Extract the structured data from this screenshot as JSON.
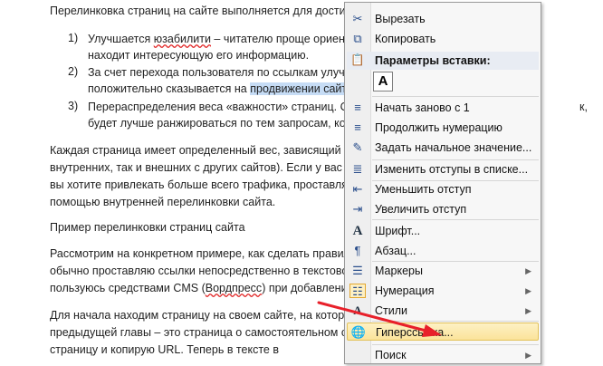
{
  "document": {
    "intro": "Перелинковка страниц на сайте выполняется для достиже",
    "list": [
      {
        "num": "1)",
        "line1": "Улучшается юзабилити – читателю проще ориенти",
        "line2": "находит интересующую его информацию."
      },
      {
        "num": "2)",
        "line1": "За счет перехода пользователя по ссылкам улучша",
        "line2a": "положительно сказывается на ",
        "line2b": "продвижении сайта"
      },
      {
        "num": "3)",
        "line1": "Перераспределения веса «важности» страниц. Стр",
        "line2": "будет лучше ранжироваться по тем запросам, кото"
      }
    ],
    "para1": [
      "Каждая страница имеет определенный вес, зависящий от",
      "внутренних, так и внешних с других сайтов). Если у вас на",
      "вы хотите привлекать больше всего трафика, проставляйт",
      "помощью внутренней перелинковки сайта."
    ],
    "heading": "Пример перелинковки страниц сайта",
    "para2": [
      "Рассмотрим на конкретном примере, как сделать правиль",
      "обычно проставляю ссылки непосредственно в текстовом",
      "пользуюсь средствами CMS (Вордпресс) при добавлении"
    ],
    "para3": [
      "Для начала находим страницу на своем сайте, на которую",
      "предыдущей главы – это страница о самостоятельном сео",
      "страницу и копирую URL. Теперь в тексте в"
    ],
    "right_frag": "к,"
  },
  "context_menu": {
    "cut": "Вырезать",
    "copy": "Копировать",
    "paste_options": "Параметры вставки:",
    "paste_btn": "A",
    "restart": "Начать заново с 1",
    "continue": "Продолжить нумерацию",
    "set_value": "Задать начальное значение...",
    "change_indent": "Изменить отступы в списке...",
    "decrease": "Уменьшить отступ",
    "increase": "Увеличить отступ",
    "font": "Шрифт...",
    "paragraph": "Абзац...",
    "bullets": "Маркеры",
    "numbering": "Нумерация",
    "styles": "Стили",
    "hyperlink": "Гиперссылка...",
    "search": "Поиск"
  },
  "colors": {
    "arrow": "#e8202a",
    "highlight": "#c6dcf5",
    "hover": "#fbe39a"
  }
}
